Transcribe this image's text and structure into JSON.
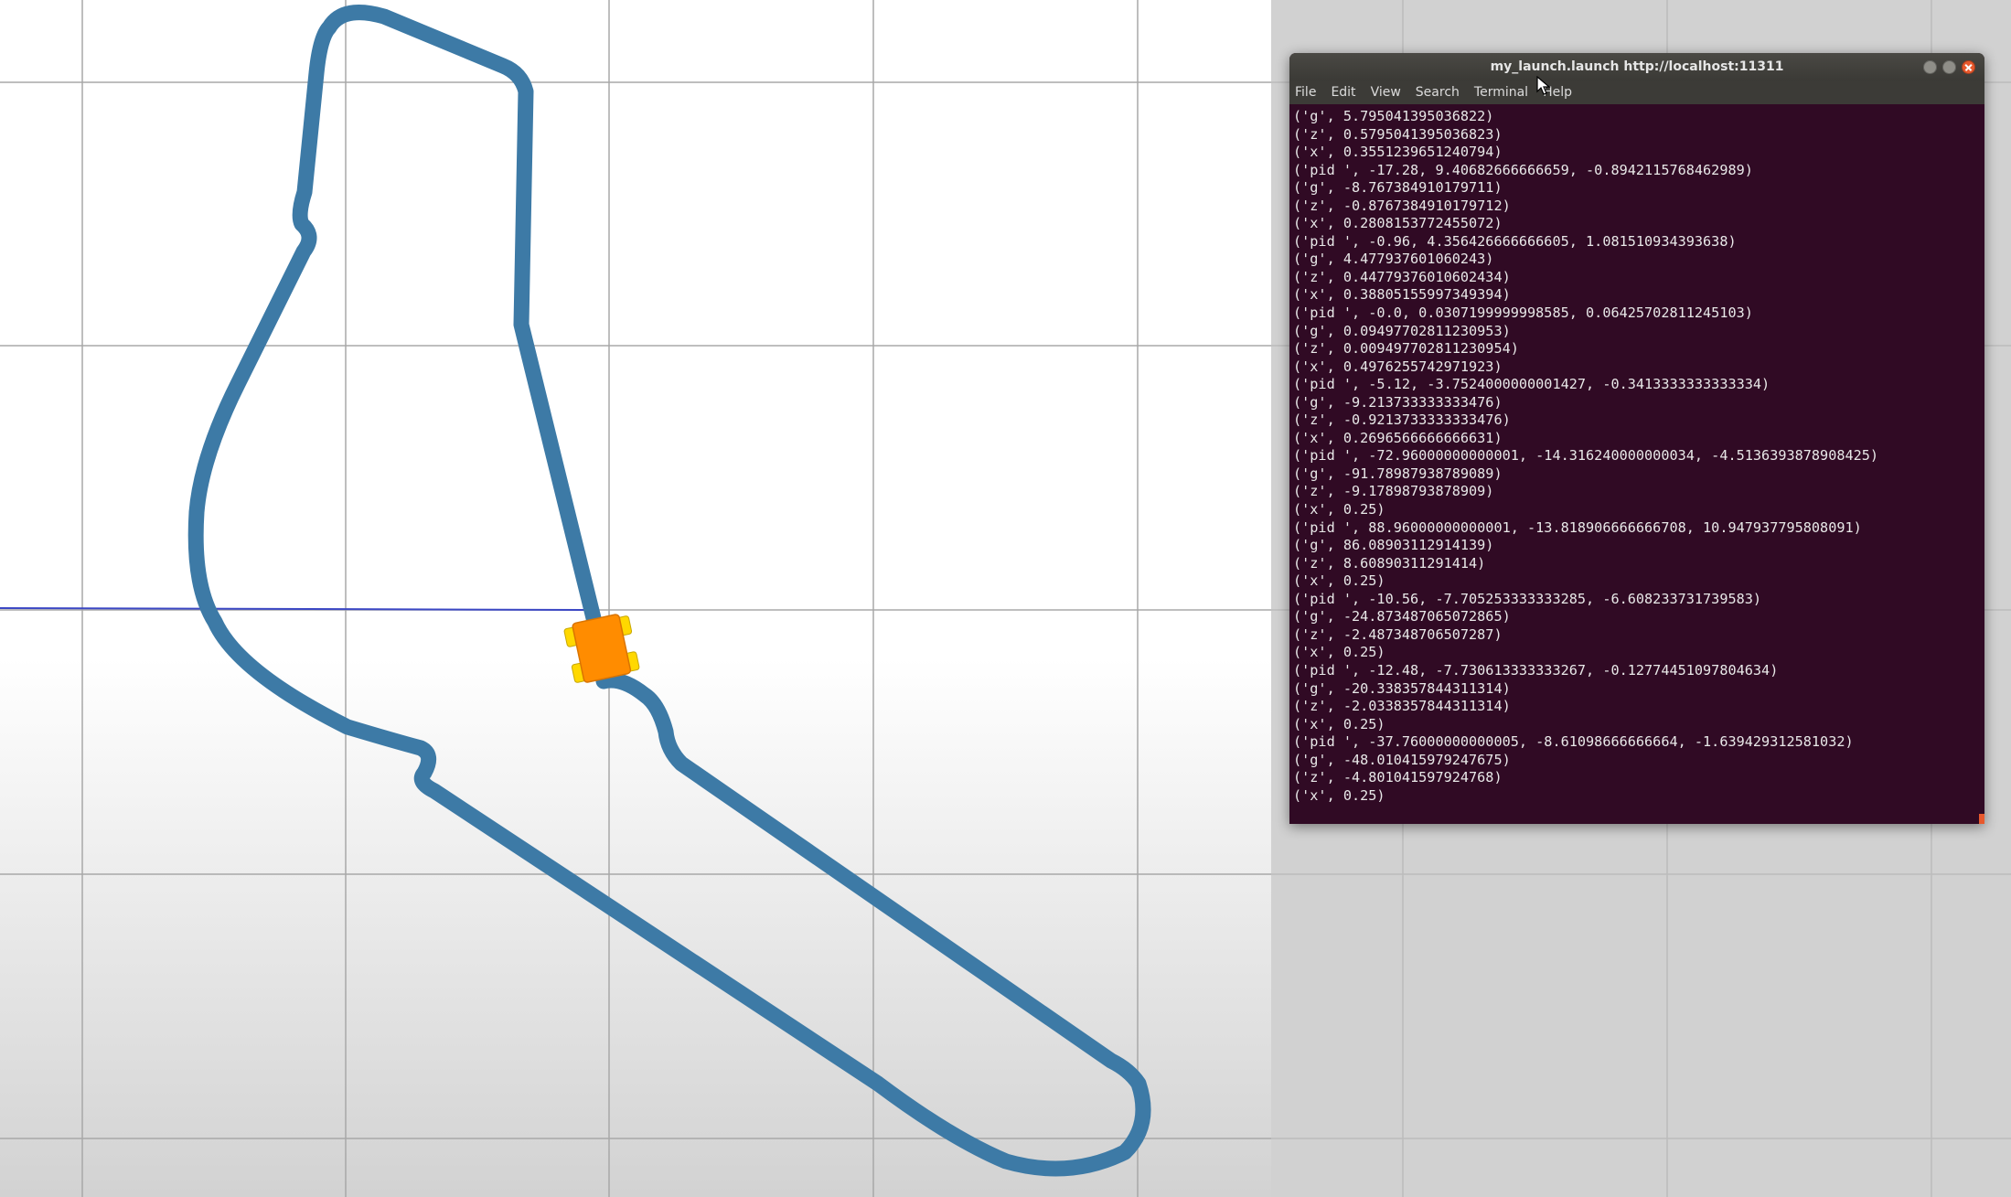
{
  "simulation": {
    "background_top": "#ffffff",
    "background_bottom": "#d4d4d4",
    "grid_color": "#a8a8a8",
    "track_color": "#3d7aa6",
    "axis_line_color": "#3b47c4",
    "robot_body_color": "#ff8c00",
    "robot_wheel_color": "#ffd800"
  },
  "desktop": {
    "background": "#d1d1d1",
    "grid_color": "#bcbcbc"
  },
  "terminal": {
    "title": "my_launch.launch http://localhost:11311",
    "background": "#300a24",
    "menu": [
      "File",
      "Edit",
      "View",
      "Search",
      "Terminal",
      "Help"
    ],
    "lines": [
      "('g', 5.795041395036822)",
      "('z', 0.5795041395036823)",
      "('x', 0.3551239651240794)",
      "('pid ', -17.28, 9.40682666666659, -0.8942115768462989)",
      "('g', -8.767384910179711)",
      "('z', -0.8767384910179712)",
      "('x', 0.2808153772455072)",
      "('pid ', -0.96, 4.356426666666605, 1.081510934393638)",
      "('g', 4.477937601060243)",
      "('z', 0.44779376010602434)",
      "('x', 0.38805155997349394)",
      "('pid ', -0.0, 0.0307199999998585, 0.06425702811245103)",
      "('g', 0.09497702811230953)",
      "('z', 0.009497702811230954)",
      "('x', 0.4976255742971923)",
      "('pid ', -5.12, -3.7524000000001427, -0.3413333333333334)",
      "('g', -9.213733333333476)",
      "('z', -0.9213733333333476)",
      "('x', 0.2696566666666631)",
      "('pid ', -72.96000000000001, -14.316240000000034, -4.5136393878908425)",
      "('g', -91.78987938789089)",
      "('z', -9.17898793878909)",
      "('x', 0.25)",
      "('pid ', 88.96000000000001, -13.818906666666708, 10.947937795808091)",
      "('g', 86.08903112914139)",
      "('z', 8.60890311291414)",
      "('x', 0.25)",
      "('pid ', -10.56, -7.705253333333285, -6.608233731739583)",
      "('g', -24.873487065072865)",
      "('z', -2.487348706507287)",
      "('x', 0.25)",
      "('pid ', -12.48, -7.730613333333267, -0.12774451097804634)",
      "('g', -20.338357844311314)",
      "('z', -2.0338357844311314)",
      "('x', 0.25)",
      "('pid ', -37.76000000000005, -8.61098666666664, -1.639429312581032)",
      "('g', -48.010415979247675)",
      "('z', -4.801041597924768)",
      "('x', 0.25)"
    ]
  }
}
